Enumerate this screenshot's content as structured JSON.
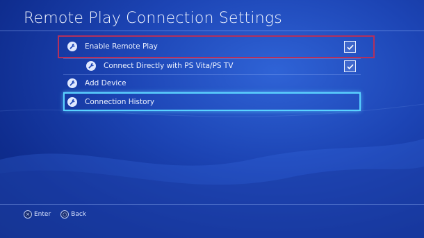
{
  "page": {
    "title": "Remote Play Connection Settings"
  },
  "settings": {
    "items": [
      {
        "label": "Enable Remote Play",
        "icon": "wrench-icon",
        "checked": true
      },
      {
        "label": "Connect Directly with PS Vita/PS TV",
        "icon": "wrench-icon",
        "checked": true
      },
      {
        "label": "Add Device",
        "icon": "wrench-icon"
      },
      {
        "label": "Connection History",
        "icon": "wrench-icon",
        "focused": true
      }
    ]
  },
  "footer": {
    "enter": {
      "glyph": "×",
      "label": "Enter",
      "icon": "cross-button-icon"
    },
    "back": {
      "glyph": "○",
      "label": "Back",
      "icon": "circle-button-icon"
    }
  },
  "colors": {
    "background": "#1c44b4",
    "highlight_red": "#b3305c",
    "focus_cyan": "#5ad2ff"
  }
}
